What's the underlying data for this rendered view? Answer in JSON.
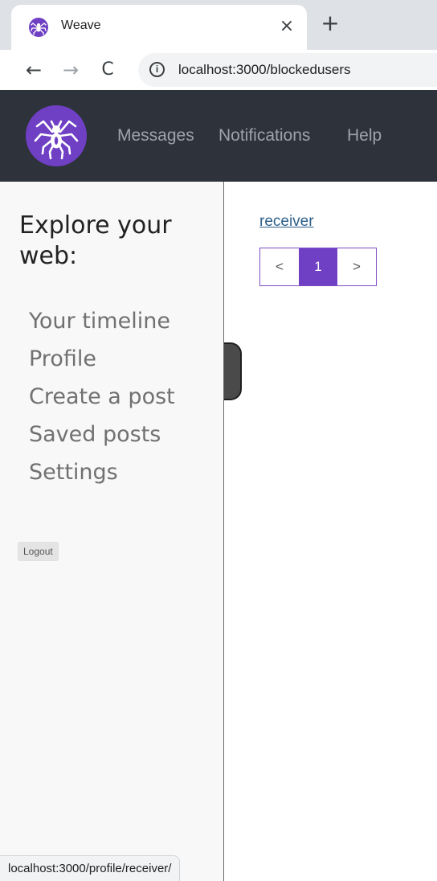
{
  "browser": {
    "tab_title": "Weave",
    "tab_close_glyph": "×",
    "new_tab_glyph": "+",
    "back_glyph": "←",
    "forward_glyph": "→",
    "reload_glyph": "C",
    "info_glyph": "i",
    "url": "localhost:3000/blockedusers",
    "status_url": "localhost:3000/profile/receiver/"
  },
  "navbar": {
    "logo_icon": "spider-icon",
    "links": [
      "Messages",
      "Notifications",
      "Help"
    ]
  },
  "sidebar": {
    "heading": "Explore your web:",
    "items": [
      "Your timeline",
      "Profile",
      "Create a post",
      "Saved posts",
      "Settings"
    ],
    "logout_label": "Logout"
  },
  "main": {
    "blocked_users": [
      "receiver"
    ],
    "pagination": {
      "prev_label": "<",
      "current_page": "1",
      "next_label": ">"
    }
  },
  "colors": {
    "accent": "#6f3fc4",
    "navbar_bg": "#2e333b",
    "sidebar_bg": "#f8f8f9",
    "link": "#2c5f8a"
  }
}
